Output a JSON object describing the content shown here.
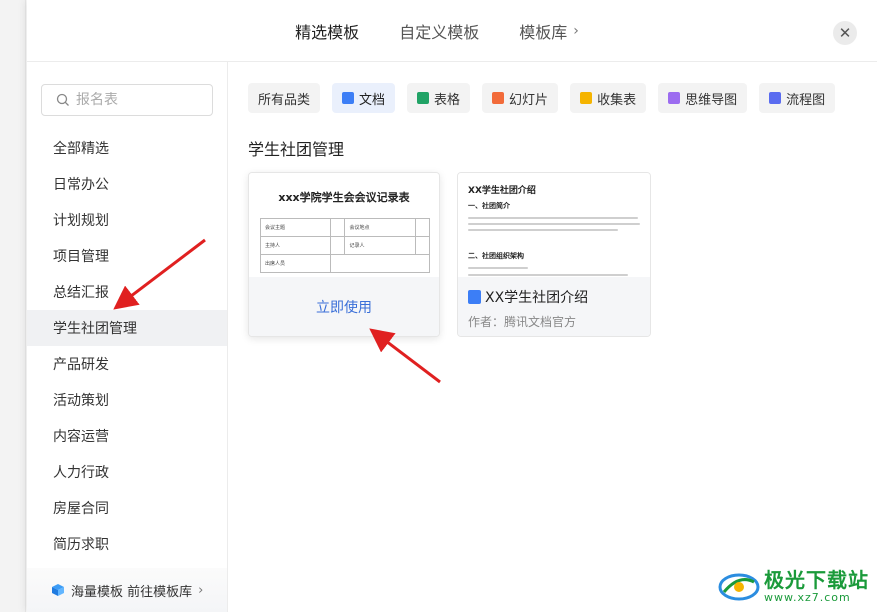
{
  "header": {
    "tabs": [
      {
        "label": "精选模板",
        "active": true
      },
      {
        "label": "自定义模板",
        "active": false
      },
      {
        "label": "模板库",
        "active": false
      }
    ],
    "close_icon": "close-icon"
  },
  "sidebar": {
    "search_placeholder": "报名表",
    "categories": [
      {
        "label": "全部精选"
      },
      {
        "label": "日常办公"
      },
      {
        "label": "计划规划"
      },
      {
        "label": "项目管理"
      },
      {
        "label": "总结汇报"
      },
      {
        "label": "学生社团管理",
        "active": true
      },
      {
        "label": "产品研发"
      },
      {
        "label": "活动策划"
      },
      {
        "label": "内容运营"
      },
      {
        "label": "人力行政"
      },
      {
        "label": "房屋合同"
      },
      {
        "label": "简历求职"
      }
    ],
    "footer": {
      "label": "海量模板 前往模板库"
    }
  },
  "filters": [
    {
      "label": "所有品类",
      "active": false
    },
    {
      "label": "文档",
      "active": true,
      "icon_color": "#3c7ef6"
    },
    {
      "label": "表格",
      "active": false,
      "icon_color": "#21a366"
    },
    {
      "label": "幻灯片",
      "active": false,
      "icon_color": "#f26b3a"
    },
    {
      "label": "收集表",
      "active": false,
      "icon_color": "#f5b400"
    },
    {
      "label": "思维导图",
      "active": false,
      "icon_color": "#9c6cf0"
    },
    {
      "label": "流程图",
      "active": false,
      "icon_color": "#5a6cf0"
    }
  ],
  "section_title": "学生社团管理",
  "cards": [
    {
      "preview_title": "xxx学院学生会会议记录表",
      "table": [
        [
          "会议主题",
          "",
          "会议地点",
          ""
        ],
        [
          "主持人",
          "",
          "记录人",
          ""
        ],
        [
          "出席人员",
          "",
          "",
          ""
        ]
      ],
      "action_label": "立即使用"
    },
    {
      "preview_title": "XX学生社团介绍",
      "preview_h1": "一、社团简介",
      "preview_h2": "二、社团组织架构",
      "title": "XX学生社团介绍",
      "author": "作者：腾讯文档官方"
    }
  ],
  "watermark": {
    "name": "极光下载站",
    "url": "www.xz7.com"
  },
  "colors": {
    "accent": "#3a6fd8",
    "arrow": "#e02020",
    "brand_green": "#1a9a3a"
  }
}
